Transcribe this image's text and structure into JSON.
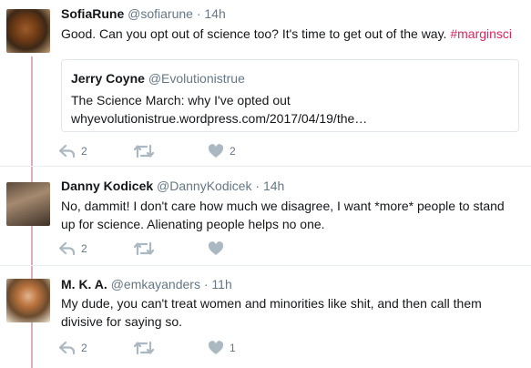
{
  "tweets": [
    {
      "name": "SofiaRune",
      "handle": "@sofiarune",
      "separator": "·",
      "time": "14h",
      "text": "Good. Can you opt out of science too? It's time to get out of the way. ",
      "hashtag": "#marginsci",
      "quote": {
        "name": "Jerry Coyne",
        "handle": "@Evolutionistrue",
        "line1": "The Science March: why I've opted out",
        "line2": "whyevolutionistrue.wordpress.com/2017/04/19/the…"
      },
      "reply_count": "2",
      "retweet_count": "",
      "like_count": "2"
    },
    {
      "name": "Danny Kodicek",
      "handle": "@DannyKodicek",
      "separator": "·",
      "time": "14h",
      "text": "No, dammit! I don't care how much we disagree, I want *more* people to stand up for science. Alienating people helps no one.",
      "reply_count": "2",
      "retweet_count": "",
      "like_count": ""
    },
    {
      "name": "M. K. A.",
      "handle": "@emkayanders",
      "separator": "·",
      "time": "11h",
      "text": "My dude, you can't treat women and minorities like shit, and then call them divisive for saying so.",
      "reply_count": "2",
      "retweet_count": "",
      "like_count": "1"
    }
  ],
  "colors": {
    "hashtag": "#e0245e",
    "thread_line": "#d69fb4",
    "icon": "#aab8c2",
    "secondary_text": "#657786"
  },
  "icons": [
    "reply-icon",
    "retweet-icon",
    "heart-icon"
  ]
}
